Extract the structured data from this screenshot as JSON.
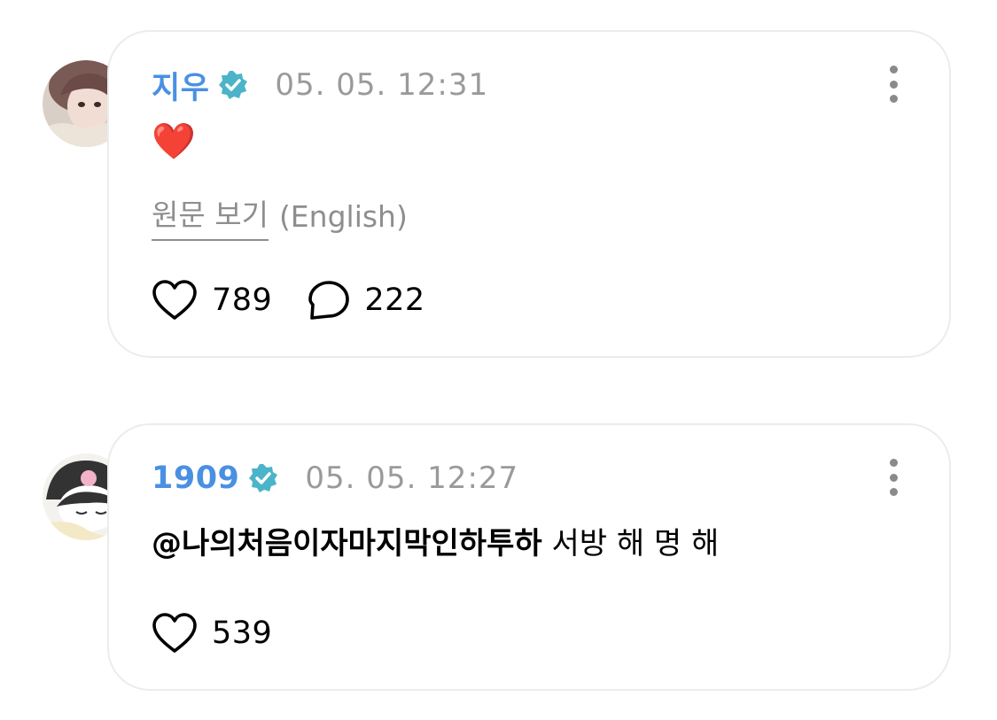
{
  "comments": [
    {
      "username": "지우",
      "timestamp": "05. 05. 12:31",
      "content": "❤️",
      "translation": {
        "link_label": "원문 보기",
        "language": "(English)"
      },
      "likes": "789",
      "replies": "222",
      "avatar_icon": "user-photo-avatar"
    },
    {
      "username": "1909",
      "timestamp": "05. 05. 12:27",
      "mention": "@나의처음이자마지막인하투하",
      "text": " 서방 해 명 해",
      "likes": "539",
      "avatar_icon": "kuromi-avatar"
    }
  ],
  "colors": {
    "username": "#4a90e2",
    "verified_badge": "#4cb4c8",
    "timestamp": "#9a9a9a",
    "card_border": "#ececec",
    "muted_text": "#8e8e8e"
  }
}
